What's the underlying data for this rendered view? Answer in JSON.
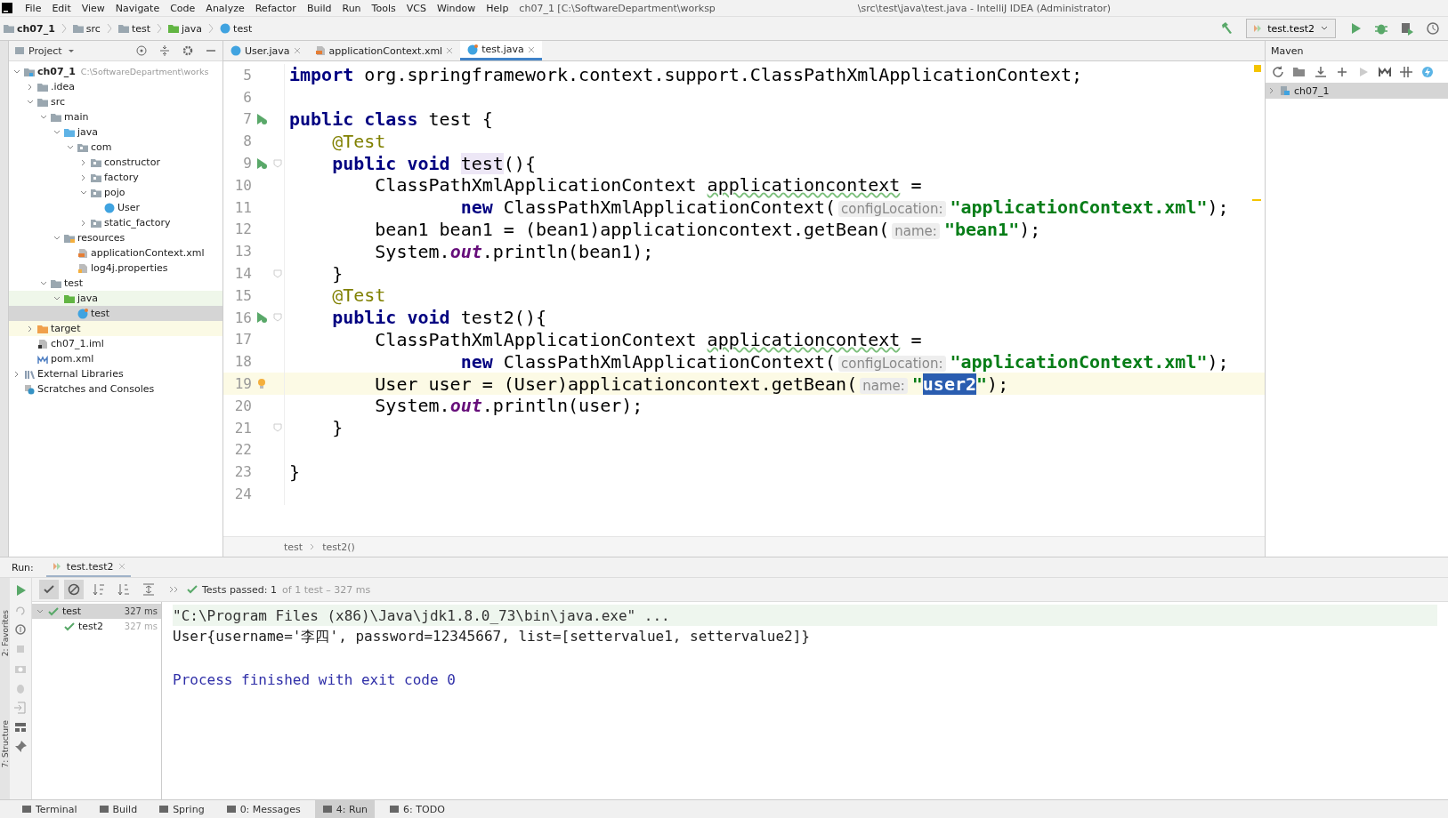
{
  "menu": [
    "File",
    "Edit",
    "View",
    "Navigate",
    "Code",
    "Analyze",
    "Refactor",
    "Build",
    "Run",
    "Tools",
    "VCS",
    "Window",
    "Help"
  ],
  "window": {
    "title": "ch07_1 [C:\\SoftwareDepartment\\worksp",
    "title_rest": "\\src\\test\\java\\test.java - IntelliJ IDEA (Administrator)"
  },
  "navbar": [
    {
      "label": "ch07_1",
      "kind": "module"
    },
    {
      "label": "src",
      "kind": "folder"
    },
    {
      "label": "test",
      "kind": "folder"
    },
    {
      "label": "java",
      "kind": "test-folder"
    },
    {
      "label": "test",
      "kind": "class"
    }
  ],
  "run_config": "test.test2",
  "project_panel": {
    "title": "Project",
    "tree": [
      {
        "label": "ch07_1",
        "path": "C:\\SoftwareDepartment\\works",
        "kind": "module",
        "expanded": true,
        "selected": false,
        "children": [
          {
            "label": ".idea",
            "kind": "folder",
            "expanded": false,
            "selected": false
          },
          {
            "label": "src",
            "kind": "folder",
            "expanded": true,
            "selected": false,
            "children": [
              {
                "label": "main",
                "kind": "folder",
                "expanded": true,
                "selected": false,
                "children": [
                  {
                    "label": "java",
                    "kind": "src-folder",
                    "expanded": true,
                    "selected": false,
                    "children": [
                      {
                        "label": "com",
                        "kind": "package",
                        "expanded": true,
                        "selected": false,
                        "children": [
                          {
                            "label": "constructor",
                            "kind": "package",
                            "expanded": false,
                            "selected": false
                          },
                          {
                            "label": "factory",
                            "kind": "package",
                            "expanded": false,
                            "selected": false
                          },
                          {
                            "label": "pojo",
                            "kind": "package",
                            "expanded": true,
                            "selected": false,
                            "children": [
                              {
                                "label": "User",
                                "kind": "class",
                                "selected": false
                              }
                            ]
                          },
                          {
                            "label": "static_factory",
                            "kind": "package",
                            "expanded": false,
                            "selected": false
                          }
                        ]
                      }
                    ]
                  },
                  {
                    "label": "resources",
                    "kind": "resources",
                    "expanded": true,
                    "selected": false,
                    "children": [
                      {
                        "label": "applicationContext.xml",
                        "kind": "xml",
                        "selected": false
                      },
                      {
                        "label": "log4j.properties",
                        "kind": "properties",
                        "selected": false
                      }
                    ]
                  }
                ]
              },
              {
                "label": "test",
                "kind": "folder",
                "expanded": true,
                "selected": false,
                "children": [
                  {
                    "label": "java",
                    "kind": "test-folder",
                    "expanded": true,
                    "selected": false,
                    "children": [
                      {
                        "label": "test",
                        "kind": "test-class",
                        "selected": true
                      }
                    ]
                  }
                ]
              }
            ]
          },
          {
            "label": "target",
            "kind": "excluded",
            "expanded": false,
            "selected": false
          },
          {
            "label": "ch07_1.iml",
            "kind": "iml",
            "selected": false
          },
          {
            "label": "pom.xml",
            "kind": "maven",
            "selected": false
          }
        ]
      },
      {
        "label": "External Libraries",
        "kind": "libraries",
        "expanded": false,
        "selected": false
      },
      {
        "label": "Scratches and Consoles",
        "kind": "scratches",
        "selected": false
      }
    ]
  },
  "editor_tabs": [
    {
      "label": "User.java",
      "kind": "class",
      "selected": false
    },
    {
      "label": "applicationContext.xml",
      "kind": "xml",
      "selected": false
    },
    {
      "label": "test.java",
      "kind": "test-class",
      "selected": true
    }
  ],
  "code": [
    {
      "number": "5",
      "tokens": [
        {
          "kind": "kw",
          "text": "import"
        },
        {
          "kind": "plain",
          "text": " org.springframework.context.support.ClassPathXmlApplicationContext;"
        }
      ]
    },
    {
      "number": "6"
    },
    {
      "number": "7",
      "runnable": true,
      "tokens": [
        {
          "kind": "kw",
          "text": "public class"
        },
        {
          "kind": "plain",
          "text": " test {"
        }
      ]
    },
    {
      "number": "8",
      "tokens": [
        {
          "kind": "ann",
          "text": "    @Test"
        }
      ]
    },
    {
      "number": "9",
      "runnable": true,
      "fold": true,
      "tokens": [
        {
          "kind": "kw",
          "text": "    public void "
        },
        {
          "kind": "usage",
          "text": "test"
        },
        {
          "kind": "plain",
          "text": "(){"
        }
      ]
    },
    {
      "number": "10",
      "tokens": [
        {
          "kind": "plain",
          "text": "        ClassPathXmlApplicationContext "
        },
        {
          "kind": "typo",
          "text": "applicationcontext"
        },
        {
          "kind": "plain",
          "text": " ="
        }
      ]
    },
    {
      "number": "11",
      "tokens": [
        {
          "kind": "kw",
          "text": "                new"
        },
        {
          "kind": "plain",
          "text": " ClassPathXmlApplicationContext("
        },
        {
          "kind": "hint",
          "text": "configLocation:"
        },
        {
          "kind": "str",
          "text": "\"applicationContext.xml\""
        },
        {
          "kind": "plain",
          "text": ");"
        }
      ]
    },
    {
      "number": "12",
      "tokens": [
        {
          "kind": "plain",
          "text": "        bean1 bean1 = (bean1)applicationcontext.getBean("
        },
        {
          "kind": "hint",
          "text": "name:"
        },
        {
          "kind": "str",
          "text": "\"bean1\""
        },
        {
          "kind": "plain",
          "text": ");"
        }
      ]
    },
    {
      "number": "13",
      "tokens": [
        {
          "kind": "plain",
          "text": "        System."
        },
        {
          "kind": "field",
          "text": "out"
        },
        {
          "kind": "plain",
          "text": ".println(bean1);"
        }
      ]
    },
    {
      "number": "14",
      "fold": true,
      "tokens": [
        {
          "kind": "plain",
          "text": "    }"
        }
      ]
    },
    {
      "number": "15",
      "tokens": [
        {
          "kind": "ann",
          "text": "    @Test"
        }
      ]
    },
    {
      "number": "16",
      "runnable": true,
      "fold": true,
      "tokens": [
        {
          "kind": "kw",
          "text": "    public void"
        },
        {
          "kind": "plain",
          "text": " test2(){"
        }
      ]
    },
    {
      "number": "17",
      "tokens": [
        {
          "kind": "plain",
          "text": "        ClassPathXmlApplicationContext "
        },
        {
          "kind": "typo",
          "text": "applicationcontext"
        },
        {
          "kind": "plain",
          "text": " ="
        }
      ]
    },
    {
      "number": "18",
      "tokens": [
        {
          "kind": "kw",
          "text": "                new"
        },
        {
          "kind": "plain",
          "text": " ClassPathXmlApplicationContext("
        },
        {
          "kind": "hint",
          "text": "configLocation:"
        },
        {
          "kind": "str",
          "text": "\"applicationContext.xml\""
        },
        {
          "kind": "plain",
          "text": ");"
        }
      ]
    },
    {
      "number": "19",
      "bulb": true,
      "current": true,
      "tokens": [
        {
          "kind": "plain",
          "text": "        User user = (User)applicationcontext.getBean("
        },
        {
          "kind": "hint",
          "text": "name:"
        },
        {
          "kind": "str",
          "text": "\""
        },
        {
          "kind": "selection",
          "text": "user2"
        },
        {
          "kind": "str",
          "text": "\""
        },
        {
          "kind": "plain",
          "text": ");"
        }
      ]
    },
    {
      "number": "20",
      "tokens": [
        {
          "kind": "plain",
          "text": "        System."
        },
        {
          "kind": "field",
          "text": "out"
        },
        {
          "kind": "plain",
          "text": ".println(user);"
        }
      ]
    },
    {
      "number": "21",
      "fold": true,
      "tokens": [
        {
          "kind": "plain",
          "text": "    }"
        }
      ]
    },
    {
      "number": "22"
    },
    {
      "number": "23",
      "tokens": [
        {
          "kind": "plain",
          "text": "}"
        }
      ]
    },
    {
      "number": "24"
    }
  ],
  "editor_breadcrumb": [
    "test",
    "test2()"
  ],
  "maven": {
    "title": "Maven",
    "items": [
      {
        "label": "ch07_1",
        "expanded": false,
        "selected": true
      }
    ]
  },
  "run_panel": {
    "label": "Run:",
    "tab": "test.test2",
    "status": "Tests passed: 1",
    "status_detail": "of 1 test – 327 ms",
    "tests": [
      {
        "label": "test",
        "time": "327 ms",
        "expanded": true,
        "selected": true,
        "children": [
          {
            "label": "test2",
            "time": "327 ms",
            "selected": false
          }
        ]
      }
    ],
    "console": [
      {
        "kind": "command",
        "text": "\"C:\\Program Files (x86)\\Java\\jdk1.8.0_73\\bin\\java.exe\" ..."
      },
      {
        "kind": "output",
        "text": "User{username='李四', password=12345667, list=[settervalue1, settervalue2]}"
      },
      {
        "kind": "blank"
      },
      {
        "kind": "exit",
        "text": "Process finished with exit code 0"
      }
    ]
  },
  "side_labels": [
    "2: Favorites",
    "7: Structure"
  ],
  "tool_buttons": [
    {
      "label": "Terminal",
      "selected": false
    },
    {
      "label": "Build",
      "selected": false
    },
    {
      "label": "Spring",
      "selected": false
    },
    {
      "label": "0: Messages",
      "selected": false
    },
    {
      "label": "4: Run",
      "selected": true
    },
    {
      "label": "6: TODO",
      "selected": false
    }
  ]
}
